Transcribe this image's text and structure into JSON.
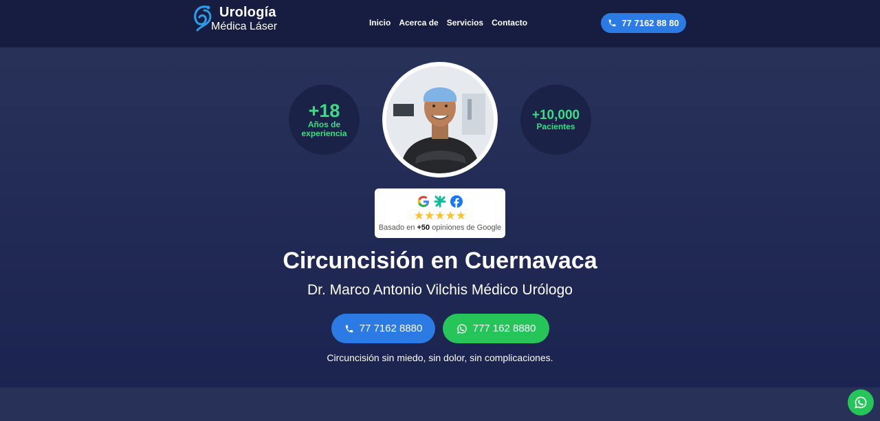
{
  "header": {
    "logo": {
      "line1": "Urología",
      "line2": "Médica Láser"
    },
    "nav": [
      {
        "label": "Inicio"
      },
      {
        "label": "Acerca de"
      },
      {
        "label": "Servicios"
      },
      {
        "label": "Contacto"
      }
    ],
    "phone_button": {
      "label": "77 7162 88 80",
      "icon": "phone-icon"
    }
  },
  "hero": {
    "stats": [
      {
        "value": "+18",
        "label_line1": "Años de",
        "label_line2": "experiencia"
      },
      {
        "value": "+10,000",
        "label": "Pacientes"
      }
    ],
    "photo": {
      "alt": "Doctor portrait"
    },
    "reviews": {
      "icons": [
        "google-icon",
        "doctoralia-icon",
        "facebook-icon"
      ],
      "stars": "★★★★★",
      "rating": 5,
      "text_prefix": "Basado en ",
      "text_bold": "+50",
      "text_suffix": " opiniones de Google"
    },
    "title": "Circuncisión en Cuernavaca",
    "subtitle": "Dr. Marco Antonio Vilchis Médico Urólogo",
    "buttons": {
      "call": {
        "label": "77 7162 8880",
        "icon": "phone-icon"
      },
      "whatsapp": {
        "label": "777 162 8880",
        "icon": "whatsapp-icon"
      }
    },
    "tagline": "Circuncisión sin miedo, sin dolor, sin complicaciones."
  },
  "floating": {
    "whatsapp_icon": "whatsapp-icon"
  },
  "colors": {
    "header_bg": "#161d41",
    "hero_bg": "#283259",
    "accent_blue": "#2c7be5",
    "accent_green": "#25c55a",
    "stat_green": "#3ddc84"
  }
}
